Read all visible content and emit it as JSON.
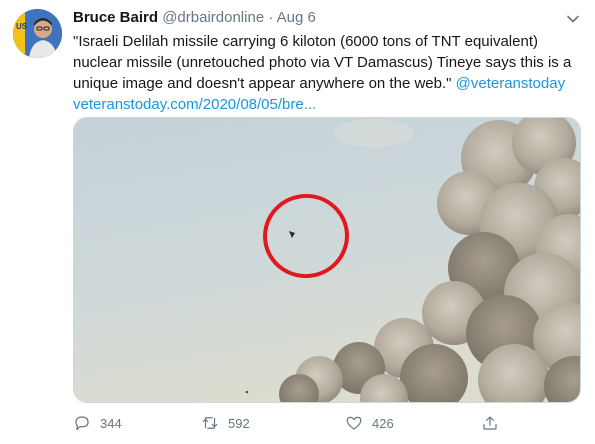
{
  "tweet": {
    "author_name": "Bruce Baird",
    "handle": "@drbairdonline",
    "separator": "·",
    "date": "Aug 6",
    "text_line1": "\"Israeli Delilah missile carrying 6 kiloton (6000 tons of TNT equivalent)",
    "text_line2": "nuclear missile (unretouched photo via VT Damascus) Tineye says this is a",
    "text_line3_plain": "unique image and doesn't appear anywhere on the web.\" ",
    "mention": "@veteranstoday",
    "url": "veteranstoday.com/2020/08/05/bre..."
  },
  "avatar_badge": "US",
  "actions": {
    "replies": "344",
    "retweets": "592",
    "likes": "426"
  },
  "colors": {
    "link": "#1b95e0",
    "secondary_text": "#657786",
    "primary_text": "#14171a",
    "highlight_circle": "#e0191e"
  },
  "icons": [
    "chevron-down-icon",
    "reply-icon",
    "retweet-icon",
    "like-icon",
    "share-icon"
  ]
}
